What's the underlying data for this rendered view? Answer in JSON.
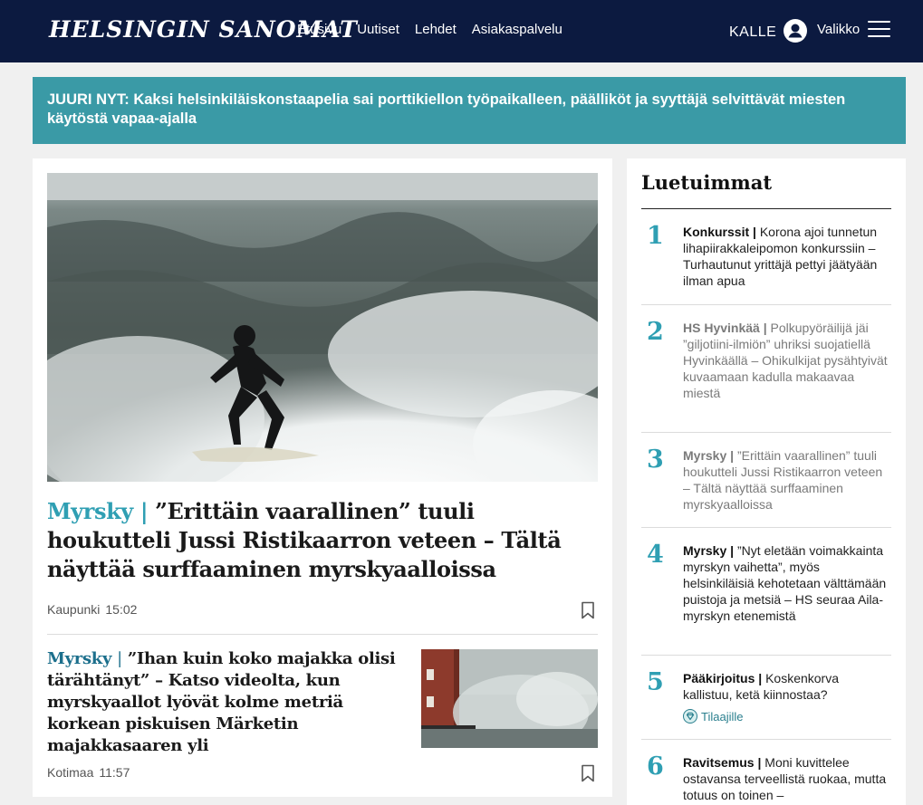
{
  "header": {
    "logo": "HELSINGIN SANOMAT",
    "nav": [
      "Etusivu",
      "Uutiset",
      "Lehdet",
      "Asiakaspalvelu"
    ],
    "user_name": "KALLE",
    "menu_label": "Valikko"
  },
  "breaking": {
    "text": "JUURI NYT: Kaksi helsinkiläiskonstaapelia sai porttikiellon työpaikalleen, päälliköt ja syyttäjä selvittävät miesten käytöstä vapaa-ajalla"
  },
  "main": {
    "hero": {
      "kicker": "Myrsky",
      "separator": "|",
      "title": "”Erittäin vaarallinen” tuuli houkutteli Jussi Ristikaarron veteen – Tältä näyttää surffaaminen myrskyaalloissa",
      "section": "Kaupunki",
      "time": "15:02",
      "image_icon": "surfer-photo"
    },
    "second": {
      "kicker": "Myrsky",
      "separator": "|",
      "title": "”Ihan kuin koko majakka olisi tärähtänyt” – Katso videolta, kun myrskyaallot lyövät kolme metriä korkean piskuisen Märketin majakkasaaren yli",
      "section": "Kotimaa",
      "time": "11:57",
      "image_icon": "lighthouse-wave-photo"
    }
  },
  "sidebar": {
    "title": "Luetuimmat",
    "items": [
      {
        "rank": "1",
        "kicker": "Konkurssit",
        "separator": "|",
        "text": "Korona ajoi tunnetun lihapiirakkaleipomon konkurssiin – Turhautunut yrittäjä pettyi jäätyään ilman apua"
      },
      {
        "rank": "2",
        "kicker": "HS Hyvinkää",
        "separator": "|",
        "text": "Polkupyöräilijä jäi ”giljotiini-ilmiön” uhriksi suojatiellä Hyvinkäällä – Ohikulkijat pysähtyivät kuvaamaan kadulla makaavaa miestä"
      },
      {
        "rank": "3",
        "kicker": "Myrsky",
        "separator": "|",
        "text": "”Erittäin vaarallinen” tuuli houkutteli Jussi Ristikaarron veteen – Tältä näyttää surffaaminen myrskyaalloissa"
      },
      {
        "rank": "4",
        "kicker": "Myrsky",
        "separator": "|",
        "text": "”Nyt eletään voimakkainta myrskyn vaihetta”, myös helsinkiläisiä kehotetaan välttämään puistoja ja metsiä – HS seuraa Aila-myrskyn etenemistä"
      },
      {
        "rank": "5",
        "kicker": "Pääkirjoitus",
        "separator": "|",
        "text": "Koskenkorva kallistuu, ketä kiinnostaa?",
        "badge": "Tilaajille"
      },
      {
        "rank": "6",
        "kicker": "Ravitsemus",
        "separator": "|",
        "text": "Moni kuvittelee ostavansa terveellistä ruokaa, mutta totuus on toinen –"
      }
    ]
  },
  "colors": {
    "header_bg": "#0c1a40",
    "breaking_bg": "#3a9aa6",
    "accent": "#2f9fb3"
  }
}
